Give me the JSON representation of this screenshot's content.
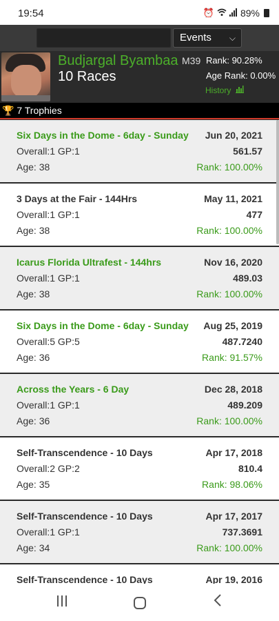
{
  "status": {
    "time": "19:54",
    "battery": "89%",
    "icons": [
      "alarm-icon",
      "wifi-icon",
      "signal-icon",
      "battery-icon"
    ]
  },
  "header": {
    "search_placeholder": "",
    "events_label": "Events"
  },
  "runner": {
    "name": "Budjargal Byambaa",
    "category": "M39",
    "rank": "Rank: 90.28%",
    "races": "10 Races",
    "age_rank": "Age Rank: 0.00%",
    "history": "History",
    "trophies": "7 Trophies"
  },
  "races": [
    {
      "name": "Six Days in the Dome - 6day - Sunday",
      "date": "Jun 20, 2021",
      "overall": "Overall:1 GP:1",
      "result": "561.57",
      "age": "Age: 38",
      "rank": "Rank: 100.00%",
      "highlight": true
    },
    {
      "name": "3 Days at the Fair - 144Hrs",
      "date": "May 11, 2021",
      "overall": "Overall:1 GP:1",
      "result": "477",
      "age": "Age: 38",
      "rank": "Rank: 100.00%",
      "highlight": false
    },
    {
      "name": "Icarus Florida Ultrafest - 144hrs",
      "date": "Nov 16, 2020",
      "overall": "Overall:1 GP:1",
      "result": "489.03",
      "age": "Age: 38",
      "rank": "Rank: 100.00%",
      "highlight": true
    },
    {
      "name": "Six Days in the Dome - 6day - Sunday",
      "date": "Aug 25, 2019",
      "overall": "Overall:5 GP:5",
      "result": "487.7240",
      "age": "Age: 36",
      "rank": "Rank: 91.57%",
      "highlight": true
    },
    {
      "name": "Across the Years - 6 Day",
      "date": "Dec 28, 2018",
      "overall": "Overall:1 GP:1",
      "result": "489.209",
      "age": "Age: 36",
      "rank": "Rank: 100.00%",
      "highlight": true
    },
    {
      "name": "Self-Transcendence - 10 Days",
      "date": "Apr 17, 2018",
      "overall": "Overall:2 GP:2",
      "result": "810.4",
      "age": "Age: 35",
      "rank": "Rank: 98.06%",
      "highlight": false
    },
    {
      "name": "Self-Transcendence - 10 Days",
      "date": "Apr 17, 2017",
      "overall": "Overall:1 GP:1",
      "result": "737.3691",
      "age": "Age: 34",
      "rank": "Rank: 100.00%",
      "highlight": false
    },
    {
      "name": "Self-Transcendence - 10 Days",
      "date": "Apr 19, 2016",
      "overall": "",
      "result": "",
      "age": "",
      "rank": "",
      "highlight": false
    }
  ],
  "colors": {
    "accent_green": "#3a9b1a",
    "header_bg": "#3a3a3a",
    "divider_red": "#d23a2a"
  }
}
